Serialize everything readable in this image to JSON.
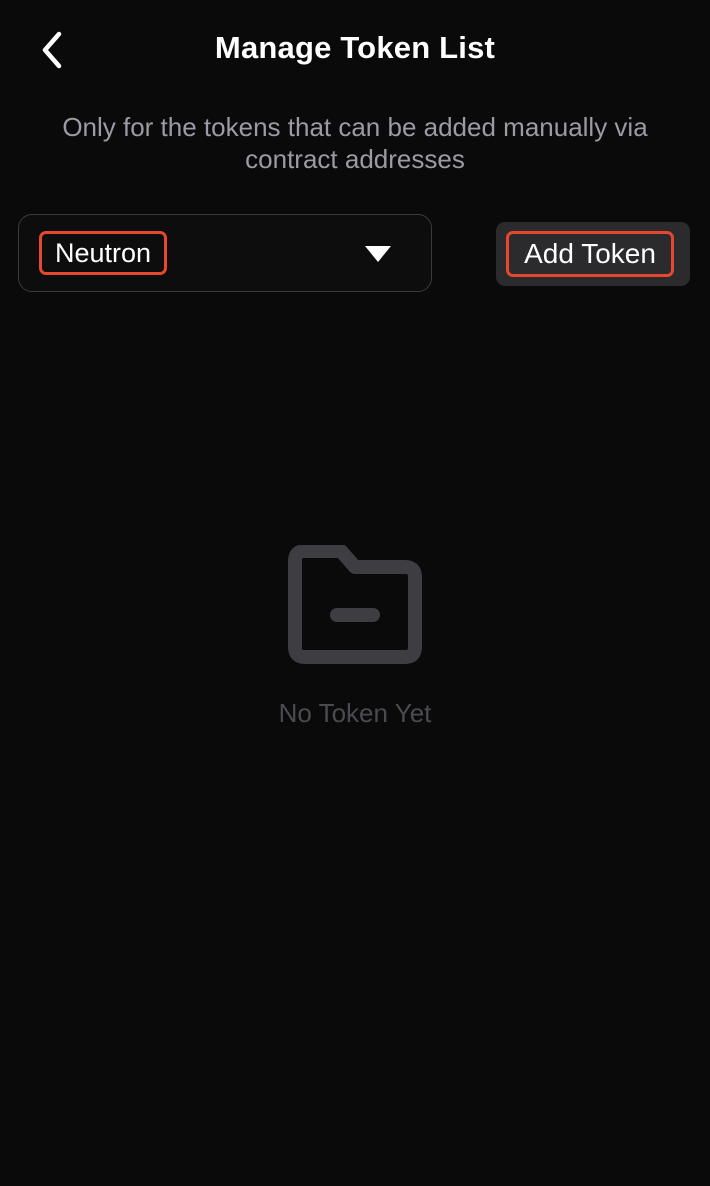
{
  "header": {
    "back_icon": "chevron-left-icon",
    "title": "Manage Token List"
  },
  "subtitle": "Only for the tokens that can be added manually via contract addresses",
  "chain_selector": {
    "selected": "Neutron",
    "caret_icon": "caret-down-icon"
  },
  "add_token": {
    "label": "Add Token"
  },
  "empty_state": {
    "icon": "folder-minus-icon",
    "message": "No Token Yet"
  },
  "colors": {
    "background": "#0a0a0a",
    "highlight": "#e8472f",
    "muted_text": "#9b9ba1",
    "empty_text": "#4a4a50",
    "button_bg": "#2b2b2e"
  }
}
